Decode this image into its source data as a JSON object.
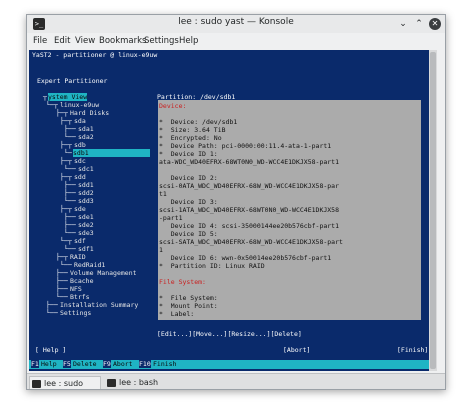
{
  "window": {
    "title": "lee : sudo yast — Konsole",
    "min_glyph": "⌄",
    "max_glyph": "⌃",
    "close_glyph": "✕"
  },
  "menu": [
    "File",
    "Edit",
    "View",
    "Bookmarks",
    "Settings",
    "Help"
  ],
  "terminal": {
    "header": "YaST2 - partitioner @ linux-e9uw",
    "panel_title": "Expert Partitioner",
    "system_view": "ystem View",
    "partition_label": "Partition: /dev/sdb1",
    "tree": [
      "linux-e9uw",
      "Hard Disks",
      "sda",
      "sda1",
      "sda2",
      "sdb",
      "sdb1",
      "sdc",
      "sdc1",
      "sdd",
      "sdd1",
      "sdd2",
      "sdd3",
      "sde",
      "sde1",
      "sde2",
      "sde3",
      "sdf",
      "sdf1",
      "RAID",
      "RedRaid1",
      "Volume Management",
      "Bcache",
      "NFS",
      "Btrfs",
      "Installation Summary",
      "Settings"
    ],
    "device_heading": "Device:",
    "device_lines": [
      "*  Device: /dev/sdb1",
      "*  Size: 3.64 TiB",
      "*  Encrypted: No",
      "*  Device Path: pci-0000:00:11.4-ata-1-part1",
      "*  Device ID 1:",
      "ata-WDC_WD40EFRX-68WT0N0_WD-WCC4E1DKJX58-part1",
      "",
      "   Device ID 2:",
      "scsi-0ATA_WDC_WD40EFRX-68W_WD-WCC4E1DKJX58-par",
      "t1",
      "   Device ID 3:",
      "scsi-1ATA_WDC_WD40EFRX-68WT0N0_WD-WCC4E1DKJX58",
      "-part1",
      "   Device ID 4: scsi-35000144ee20b576cbf-part1",
      "   Device ID 5:",
      "scsi-SATA_WDC_WD40EFRX-68W_WD-WCC4E1DKJX58-part",
      "1",
      "   Device ID 6: wwn-0x50014ee20b576cbf-part1",
      "*  Partition ID: Linux RAID"
    ],
    "fs_heading": "File System:",
    "fs_lines": [
      "*  File System:",
      "*  Mount Point:",
      "*  Label:"
    ],
    "actions": "[Edit...][Move...][Resize...][Delete]",
    "help_btn": "[ Help ]",
    "abort_btn": "[Abort]",
    "finish_btn": "[Finish]",
    "fkeys": [
      {
        "key": "F1",
        "label": "Help"
      },
      {
        "key": "F5",
        "label": "Delete"
      },
      {
        "key": "F9",
        "label": "Abort"
      },
      {
        "key": "F10",
        "label": "Finish"
      }
    ]
  },
  "tabs": [
    "lee : sudo yast",
    "lee : bash"
  ],
  "colors": {
    "terminal_bg": "#0a2a6b",
    "selection": "#1fb4c4",
    "info_bg": "#ababab",
    "heading_red": "#e64545"
  }
}
